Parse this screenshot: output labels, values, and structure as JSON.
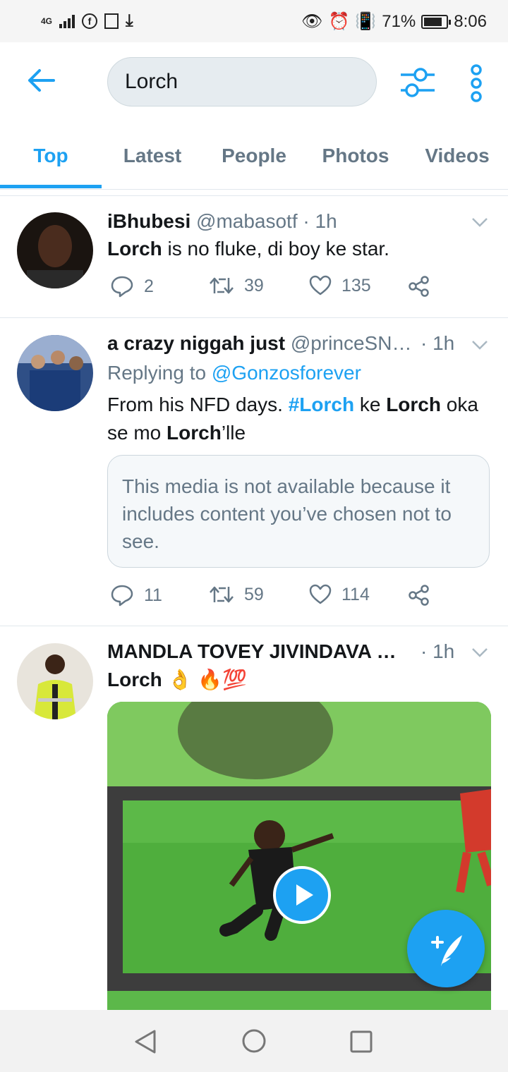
{
  "status_bar": {
    "network": "4G",
    "battery_percent": "71%",
    "time": "8:06"
  },
  "search": {
    "query": "Lorch"
  },
  "tabs": [
    {
      "label": "Top",
      "active": true
    },
    {
      "label": "Latest",
      "active": false
    },
    {
      "label": "People",
      "active": false
    },
    {
      "label": "Photos",
      "active": false
    },
    {
      "label": "Videos",
      "active": false
    }
  ],
  "tweets": [
    {
      "name": "iBhubesi",
      "handle": "@mabasotf",
      "time": "· 1h",
      "text_bold": "Lorch",
      "text_rest": " is no fluke, di boy ke star.",
      "replies": "2",
      "retweets": "39",
      "likes": "135"
    },
    {
      "name": "a crazy niggah just",
      "handle": "@princeSN…",
      "time": "· 1h",
      "replying_prefix": "Replying to ",
      "replying_to": "@Gonzosforever",
      "text_1": "From his NFD days. ",
      "hashtag": "#Lorch",
      "text_2": " ke ",
      "bold_1": "Lorch",
      "text_3": " oka se mo ",
      "bold_2": "Lorch",
      "text_4": "’lle",
      "media_notice": "This media is not available because it includes content you’ve chosen not to see.",
      "replies": "11",
      "retweets": "59",
      "likes": "114"
    },
    {
      "name": "MANDLA TOVEY JIVINDAVA …",
      "time": "· 1h",
      "text_bold": "Lorch",
      "emoji": "👌 🔥💯"
    }
  ],
  "colors": {
    "accent": "#1da1f2",
    "muted": "#657786",
    "text": "#14171a"
  }
}
